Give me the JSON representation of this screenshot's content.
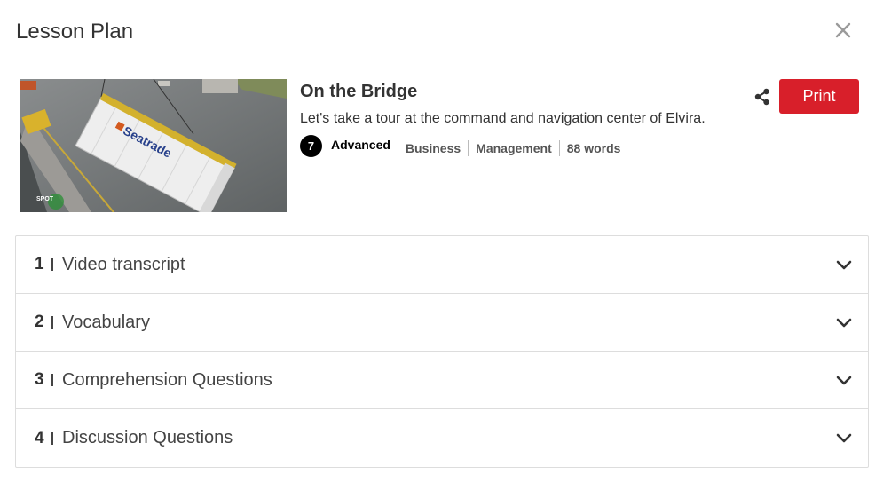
{
  "modal": {
    "title": "Lesson Plan",
    "close_icon": "close-icon"
  },
  "lesson": {
    "thumbnail": {
      "container_text": "Seatrade",
      "watermark": "SPOT"
    },
    "title": "On the Bridge",
    "description": "Let's take a tour at the command and navigation center of Elvira.",
    "level_number": "7",
    "level_label": "Advanced",
    "tags": [
      "Business",
      "Management",
      "88 words"
    ],
    "share_icon": "share-icon",
    "print_label": "Print",
    "print_color": "#d81f2a"
  },
  "sections": [
    {
      "number": "1",
      "label": "Video transcript"
    },
    {
      "number": "2",
      "label": "Vocabulary"
    },
    {
      "number": "3",
      "label": "Comprehension Questions"
    },
    {
      "number": "4",
      "label": "Discussion Questions"
    }
  ]
}
